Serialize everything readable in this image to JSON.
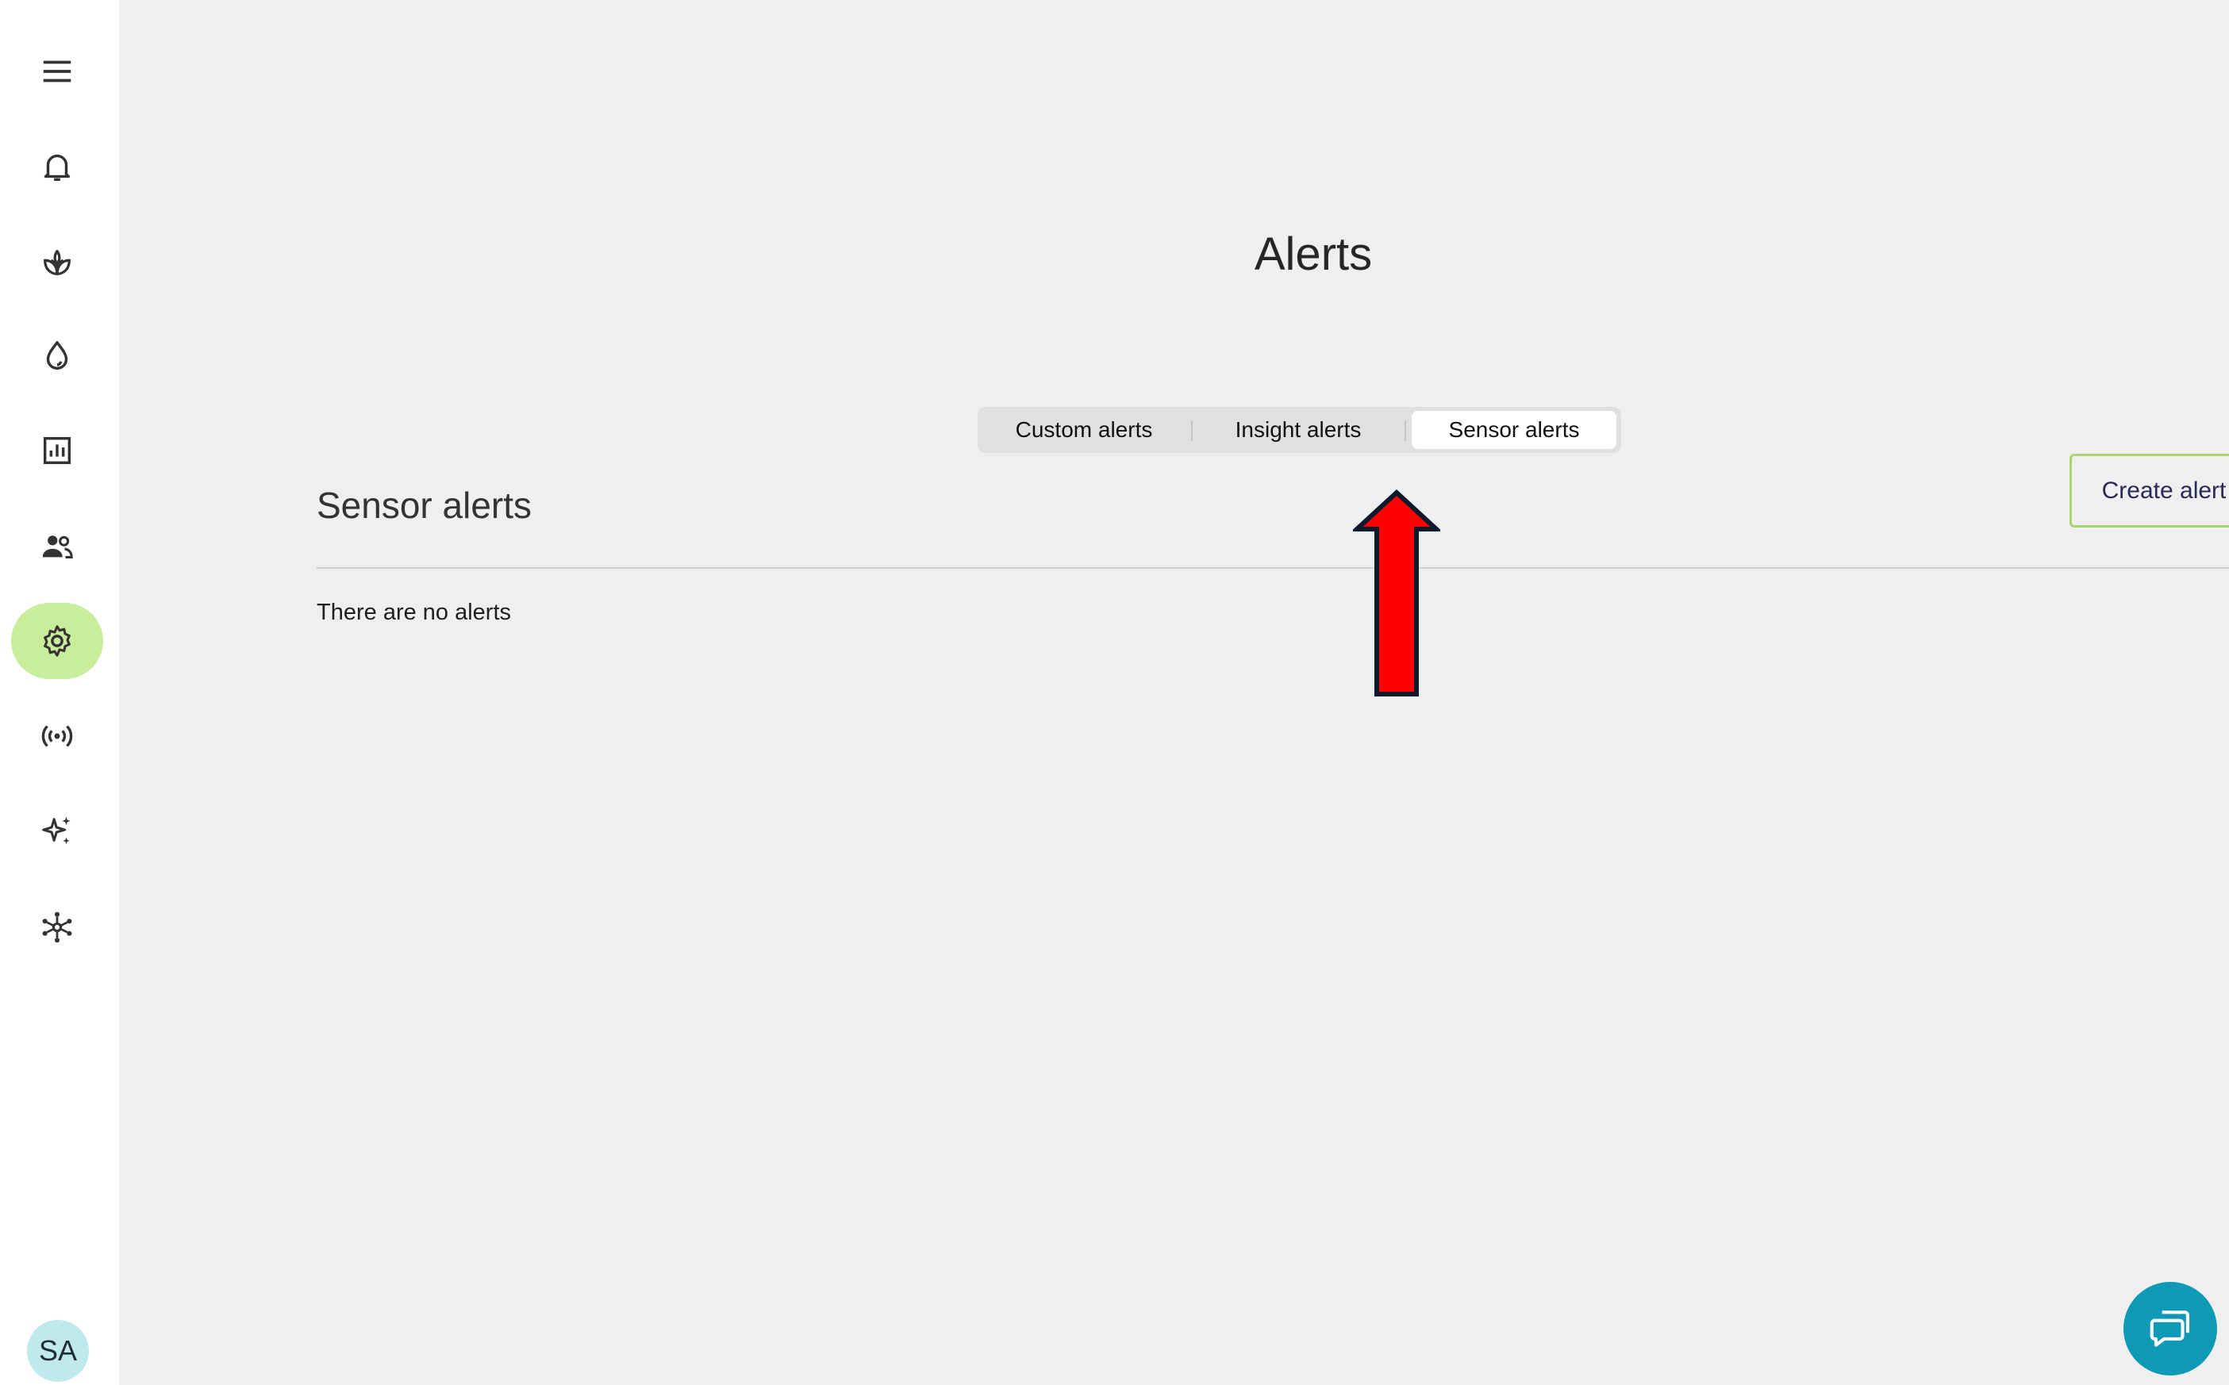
{
  "sidebar": {
    "items": [
      {
        "icon": "menu-icon"
      },
      {
        "icon": "bell-icon"
      },
      {
        "icon": "plant-icon"
      },
      {
        "icon": "water-drop-icon"
      },
      {
        "icon": "bar-chart-icon"
      },
      {
        "icon": "users-icon"
      },
      {
        "icon": "gear-icon",
        "active": true
      },
      {
        "icon": "broadcast-icon"
      },
      {
        "icon": "sparkles-icon"
      },
      {
        "icon": "network-icon"
      }
    ],
    "avatar_initials": "SA"
  },
  "main": {
    "title": "Alerts",
    "tabs": [
      {
        "label": "Custom alerts"
      },
      {
        "label": "Insight alerts"
      },
      {
        "label": "Sensor alerts",
        "active": true
      }
    ],
    "section_title": "Sensor alerts",
    "create_button_label": "Create alert",
    "empty_message": "There are no alerts"
  },
  "annotation": {
    "type": "arrow",
    "color": "#ff0000",
    "outline": "#0d1a2e"
  },
  "chat": {
    "icon": "chat-icon"
  },
  "colors": {
    "accent_green": "#c8ee9c",
    "button_border": "#a9d46b",
    "chat_bg": "#0e9ab7",
    "avatar_bg": "#bfe9ec"
  }
}
